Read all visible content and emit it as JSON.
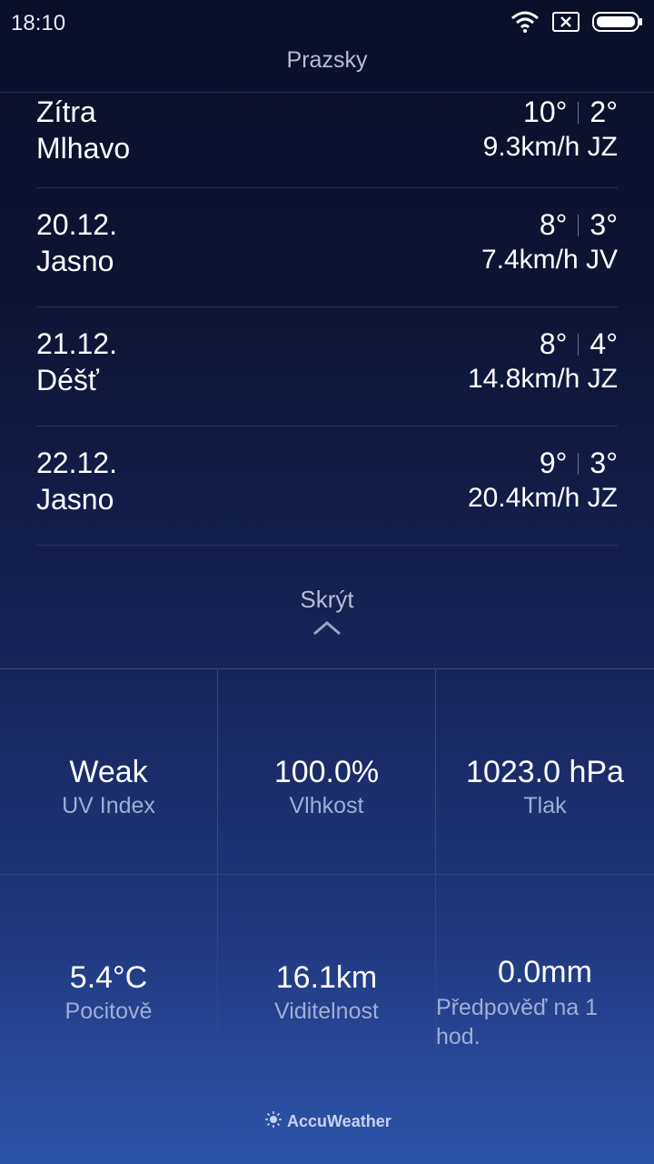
{
  "status": {
    "time": "18:10"
  },
  "title": "Prazsky",
  "forecast": [
    {
      "date": "Zítra",
      "condition": "Mlhavo",
      "high": "10°",
      "low": "2°",
      "wind": "9.3km/h JZ"
    },
    {
      "date": "20.12.",
      "condition": "Jasno",
      "high": "8°",
      "low": "3°",
      "wind": "7.4km/h JV"
    },
    {
      "date": "21.12.",
      "condition": "Déšť",
      "high": "8°",
      "low": "4°",
      "wind": "14.8km/h JZ"
    },
    {
      "date": "22.12.",
      "condition": "Jasno",
      "high": "9°",
      "low": "3°",
      "wind": "20.4km/h JZ"
    }
  ],
  "toggle": {
    "label": "Skrýt"
  },
  "details": [
    {
      "value": "Weak",
      "label": "UV Index"
    },
    {
      "value": "100.0%",
      "label": "Vlhkost"
    },
    {
      "value": "1023.0 hPa",
      "label": "Tlak"
    },
    {
      "value": "5.4°C",
      "label": "Pocitově"
    },
    {
      "value": "16.1km",
      "label": "Viditelnost"
    },
    {
      "value": "0.0mm",
      "label": "Předpověď na 1 hod."
    }
  ],
  "footer": {
    "brand": "AccuWeather"
  }
}
